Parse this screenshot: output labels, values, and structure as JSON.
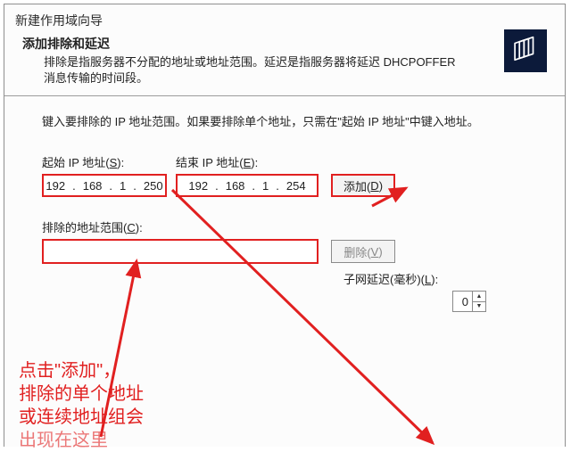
{
  "window": {
    "title": "新建作用域向导"
  },
  "header": {
    "heading": "添加排除和延迟",
    "desc": "排除是指服务器不分配的地址或地址范围。延迟是指服务器将延迟 DHCPOFFER 消息传输的时间段。"
  },
  "body": {
    "instruction": "键入要排除的 IP 地址范围。如果要排除单个地址，只需在\"起始 IP 地址\"中键入地址。",
    "start_label": "起始 IP 地址(S):",
    "end_label": "结束 IP 地址(E):",
    "start_ip": {
      "o1": "192",
      "o2": "168",
      "o3": "1",
      "o4": "250"
    },
    "end_ip": {
      "o1": "192",
      "o2": "168",
      "o3": "1",
      "o4": "254"
    },
    "add_button": "添加(D)",
    "list_label": "排除的地址范围(C):",
    "remove_button": "删除(V)",
    "delay_label": "子网延迟(毫秒)(L):",
    "delay_value": "0"
  },
  "annotation": {
    "l1": "点击\"添加\"，",
    "l2": "排除的单个地址",
    "l3": "或连续地址组会",
    "l4": "出现在这里"
  },
  "colors": {
    "red": "#e12020"
  }
}
